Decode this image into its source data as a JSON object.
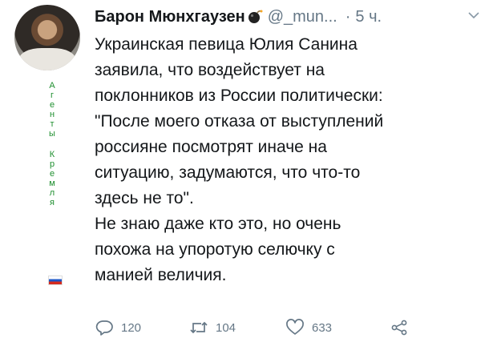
{
  "tweet": {
    "author_name": "Барон Мюнхгаузен",
    "handle": "@_mun...",
    "time": "5 ч.",
    "lines": [
      "Украинская певица Юлия Санина",
      "заявила, что воздействует на",
      "поклонников из России политически:",
      "\"После моего отказа от выступлений",
      "россияне посмотрят иначе на",
      "ситуацию, задумаются, что что-то",
      "здесь не то\".",
      "Не знаю даже кто это, но очень",
      "похожа на упоротую селючку с",
      "манией величия."
    ],
    "replies": "120",
    "retweets": "104",
    "likes": "633",
    "icons": {
      "reply": "reply-icon",
      "retweet": "retweet-icon",
      "like": "heart-icon",
      "share": "share-icon",
      "bomb": "bomb-emoji-icon",
      "more": "chevron-down-icon",
      "flag": "russian-flag-icon"
    }
  },
  "watermark": {
    "word1": [
      "А",
      "г",
      "е",
      "н",
      "т",
      "ы"
    ],
    "word2": [
      "К",
      "р",
      "е",
      "м",
      "л",
      "я"
    ],
    "color": "#1f8f2f"
  },
  "colors": {
    "text": "#14171a",
    "secondary": "#657786"
  }
}
